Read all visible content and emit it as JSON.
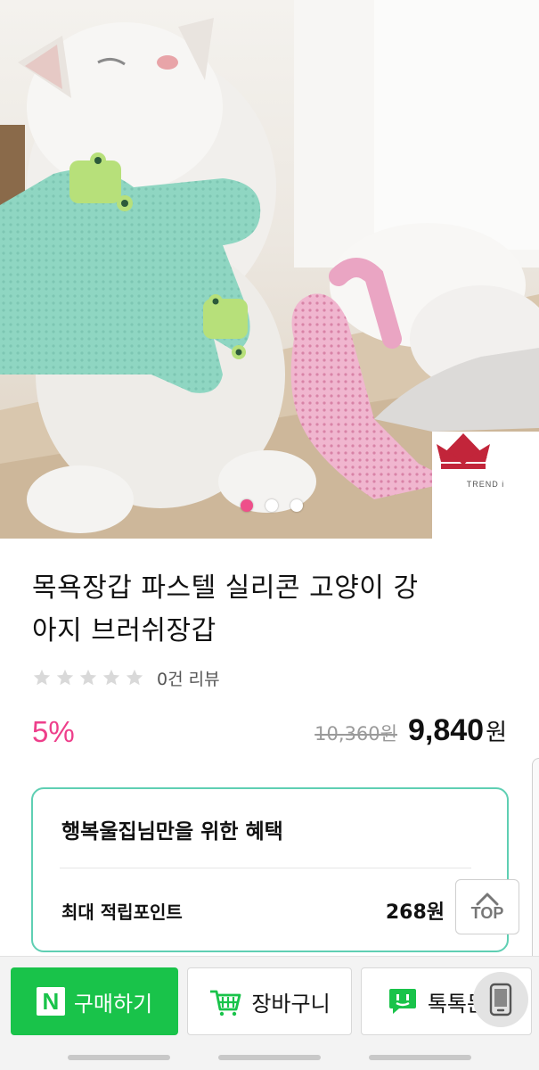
{
  "product": {
    "title_line1": "목욕장갑 파스텔 실리콘 고양이 강",
    "title_line2": "아지 브러쉬장갑",
    "rating_stars": 0,
    "review_count_text": "0건 리뷰",
    "discount_text": "5%",
    "original_price": "10,360원",
    "sale_price": "9,840",
    "sale_price_unit": "원"
  },
  "hero": {
    "carousel_count": 3,
    "carousel_active": 1,
    "brand_logo_text": "TREND i"
  },
  "benefit": {
    "title": "행복울집님만을 위한 혜택",
    "points_label": "최대 적립포인트",
    "points_value": "268원"
  },
  "top_button": {
    "label": "TOP"
  },
  "action_bar": {
    "buy_label": "구매하기",
    "buy_logo": "N",
    "cart_label": "장바구니",
    "talk_label": "톡톡문의"
  },
  "colors": {
    "accent_pink": "#ee3f8b",
    "naver_green": "#19c34a",
    "benefit_border": "#5fcfb3"
  },
  "icons": [
    "cart-icon",
    "talk-icon",
    "chevron-up-icon",
    "phone-icon",
    "star-icon"
  ]
}
